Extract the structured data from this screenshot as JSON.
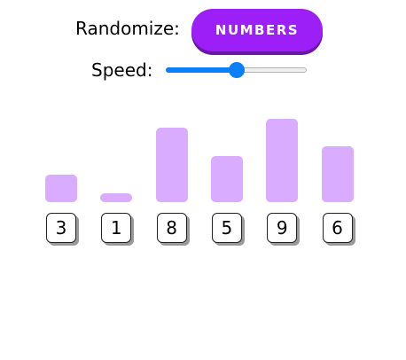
{
  "controls": {
    "randomize_label": "Randomize:",
    "numbers_button_label": "NUMBERS",
    "speed_label": "Speed:",
    "speed_level": 0.5
  },
  "colors": {
    "button": "#9b1ff6",
    "bar": "#d9acff",
    "slider": "#0b7ef9"
  },
  "chart_data": {
    "type": "bar",
    "categories": [
      "3",
      "1",
      "8",
      "5",
      "9",
      "6"
    ],
    "values": [
      3,
      1,
      8,
      5,
      9,
      6
    ]
  },
  "numbers": [
    "3",
    "1",
    "8",
    "5",
    "9",
    "6"
  ]
}
